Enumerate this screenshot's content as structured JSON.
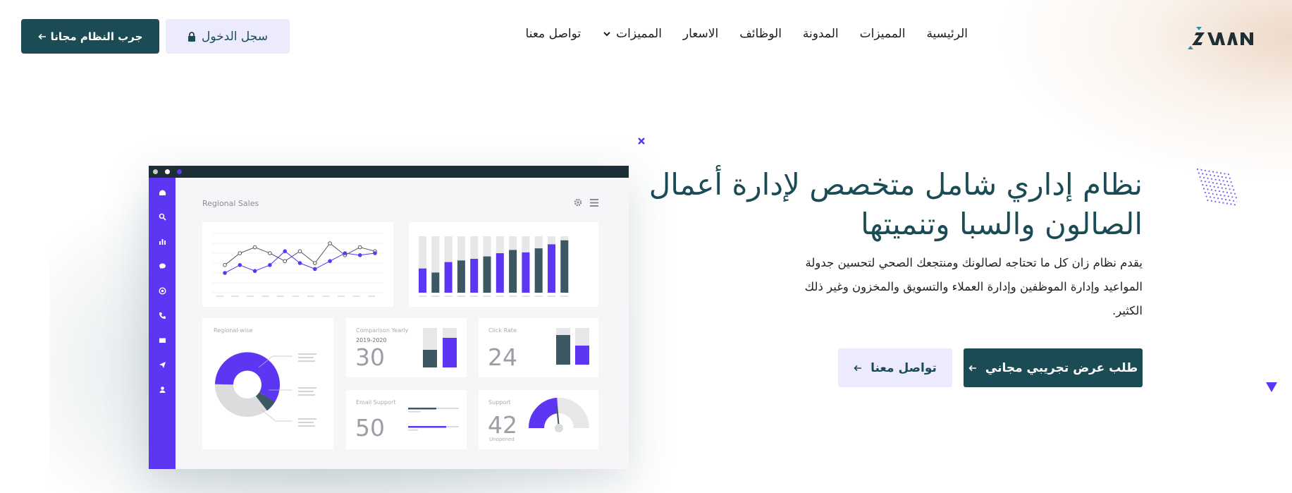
{
  "header": {
    "logo_text": "ZAAN",
    "nav": [
      {
        "label": "الرئيسية"
      },
      {
        "label": "المميزات"
      },
      {
        "label": "المدونة"
      },
      {
        "label": "الوظائف"
      },
      {
        "label": "الاسعار"
      },
      {
        "label": "المميزات",
        "dropdown": true
      },
      {
        "label": "تواصل معنا"
      }
    ],
    "login_label": "سجل الدخول",
    "try_label": "جرب النظام مجانا"
  },
  "hero": {
    "title_line1": "نظام إداري شامل متخصص لإدارة أعمال",
    "title_line2": "الصالون والسبا وتنميتها",
    "desc_line1": "يقدم نظام زان كل ما تحتاجه لصالونك ومنتجعك الصحي لتحسين جدولة",
    "desc_line2": "المواعيد وإدارة الموظفين وإدارة العملاء والتسويق والمخزون وغير ذلك",
    "desc_line3": "الكثير.",
    "demo_label": "طلب عرض تجريبي مجاني",
    "contact_label": "تواصل معنا"
  },
  "dashboard": {
    "title": "Regional Sales",
    "regional_label": "Regional-wise",
    "comparison_label": "Comparison Yearly",
    "comparison_years": "2019-2020",
    "comparison_value": "30",
    "click_label": "Click Rate",
    "click_value": "24",
    "email_label": "Email Support",
    "email_value": "50",
    "support_label": "Support",
    "support_value": "42",
    "support_sub": "Unopened",
    "line_series_a": [
      48,
      60,
      66,
      60,
      52,
      62,
      50,
      70,
      58,
      66,
      62
    ],
    "line_series_b": [
      40,
      48,
      42,
      48,
      62,
      50,
      44,
      52,
      60,
      58,
      60
    ],
    "bar_values": [
      30,
      25,
      38,
      40,
      42,
      45,
      49,
      53,
      50,
      55,
      60,
      65
    ]
  },
  "colors": {
    "primary": "#1b4b55",
    "accent": "#5c36f2",
    "light_accent": "#eceafd",
    "dark_bar": "#3d5862"
  },
  "icons": [
    "chevron-down-icon",
    "lock-icon",
    "arrow-left-icon"
  ]
}
